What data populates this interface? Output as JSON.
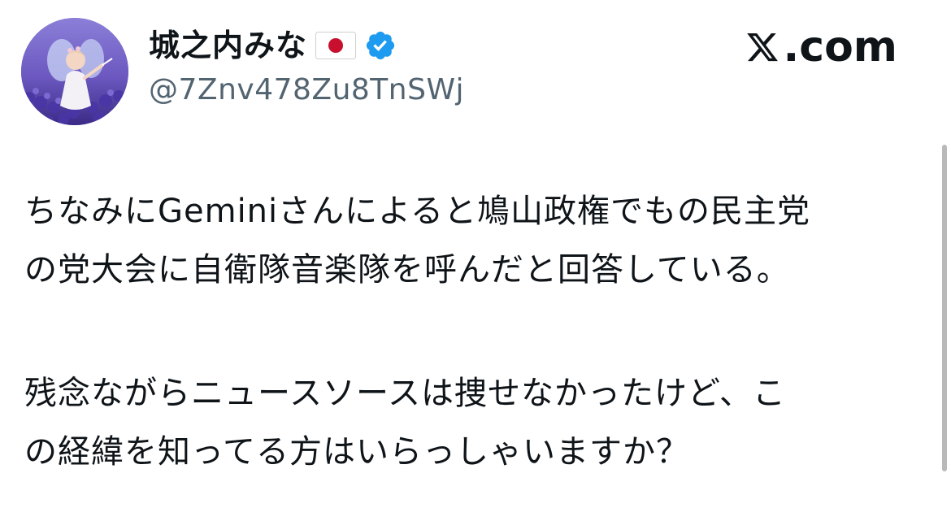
{
  "author": {
    "display_name": "城之内みな",
    "flag_icon": "japan-flag-icon",
    "verified_icon": "verified-badge-icon",
    "verified_color": "#1d9bf0",
    "handle": "@7Znv478Zu8TnSWj",
    "avatar_description_icon": "fairy-child-lavender-avatar"
  },
  "brand": {
    "label": ".com",
    "logo_icon": "x-logo-icon"
  },
  "tweet": {
    "paragraphs": [
      {
        "lines": [
          "ちなみにGeminiさんによると鳩山政権でもの民主党",
          "の党大会に自衛隊音楽隊を呼んだと回答している。"
        ]
      },
      {
        "lines": [
          "残念ながらニュースソースは捜せなかったけど、こ",
          "の経緯を知ってる方はいらっしゃいますか？"
        ]
      }
    ]
  },
  "colors": {
    "text": "#0f1419",
    "secondary_text": "#536471",
    "background": "#ffffff"
  }
}
